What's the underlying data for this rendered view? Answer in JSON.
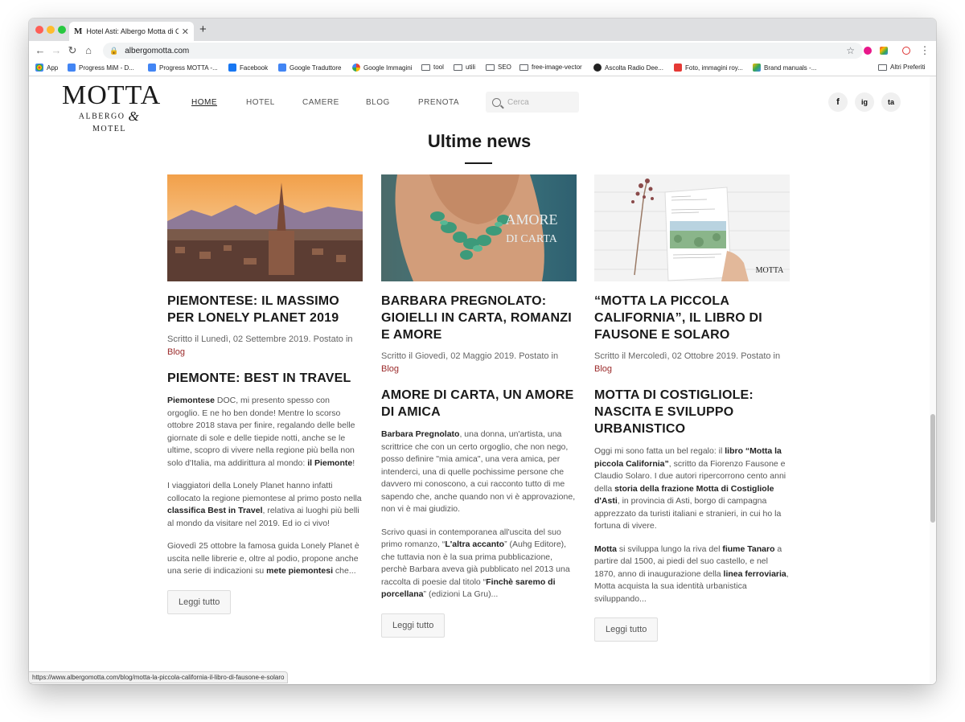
{
  "browser": {
    "tab_title": "Hotel Asti: Albergo Motta di Co",
    "tab_favicon": "M",
    "new_tab": "+",
    "url": "albergomotta.com",
    "status_url": "https://www.albergomotta.com/blog/motta-la-piccola-california-il-libro-di-fausone-e-solaro",
    "bookmarks": [
      "App",
      "Progress MiM - D...",
      "Progress MOTTA -...",
      "Facebook",
      "Google Traduttore",
      "Google Immagini",
      "tool",
      "utili",
      "SEO",
      "free-image-vector",
      "Ascolta Radio Dee...",
      "Foto, immagini roy...",
      "Brand manuals -...",
      "Altri Preferiti"
    ]
  },
  "site": {
    "logo_main": "MOTTA",
    "logo_sub_left": "ALBERGO",
    "logo_amp": "&",
    "logo_sub_right": "MOTEL",
    "nav": [
      "HOME",
      "HOTEL",
      "CAMERE",
      "BLOG",
      "PRENOTA"
    ],
    "search_placeholder": "Cerca",
    "social": [
      "f",
      "ig",
      "ta"
    ]
  },
  "section_title": "Ultime news",
  "articles": [
    {
      "title": "PIEMONTESE: IL MASSIMO PER LONELY PLANET 2019",
      "meta": "Scritto il Lunedì, 02 Settembre 2019. Postato in",
      "category": "Blog",
      "subtitle": "PIEMONTE: BEST IN TRAVEL",
      "p1_b1": "Piemontese",
      "p1_t1": " DOC, mi presento spesso con orgoglio. E ne ho ben donde! Mentre lo scorso ottobre 2018 stava per finire, regalando delle belle giornate di sole e delle tiepide notti, anche se le ultime, scopro di vivere nella regione più bella non solo d'Italia, ma addirittura al mondo: ",
      "p1_b2": "il Piemonte",
      "p1_t2": "!",
      "p2_t1": "I viaggiatori della Lonely Planet hanno infatti collocato la regione piemontese al primo posto nella ",
      "p2_b1": "classifica Best in Travel",
      "p2_t2": ", relativa ai luoghi più belli al mondo da visitare nel 2019. Ed io ci vivo!",
      "p3_t1": "Giovedì 25 ottobre la famosa guida Lonely Planet è uscita nelle librerie e, oltre al podio, propone anche una serie di indicazioni su ",
      "p3_b1": "mete piemontesi",
      "p3_t2": " che...",
      "button": "Leggi tutto"
    },
    {
      "title": "BARBARA PREGNOLATO: GIOIELLI IN CARTA, ROMANZI E AMORE",
      "meta": "Scritto il Giovedì, 02 Maggio 2019. Postato in",
      "category": "Blog",
      "subtitle": "AMORE DI CARTA, UN AMORE DI AMICA",
      "image_text_1": "AMORE",
      "image_text_2": "DI CARTA",
      "p1_b1": "Barbara Pregnolato",
      "p1_t1": ", una donna, un'artista, una scrittrice che con un certo orgoglio, che non nego, posso definire \"mia amica\", una vera amica, per intenderci, una di quelle pochissime persone che davvero mi conoscono, a cui racconto tutto di me sapendo che, anche quando non vi è approvazione, non vi è mai giudizio.",
      "p2_t1": "Scrivo quasi in contemporanea all'uscita del suo primo romanzo, “",
      "p2_b1": "L'altra accanto",
      "p2_t2": "” (Auhg Editore), che tuttavia non è la sua prima pubblicazione, perchè Barbara aveva già pubblicato nel 2013 una raccolta di poesie dal titolo “",
      "p2_b2": "Finchè saremo di porcellana",
      "p2_t3": "” (edizioni La Gru)...",
      "button": "Leggi tutto"
    },
    {
      "title": "“MOTTA LA PICCOLA CALIFORNIA”, IL LIBRO DI FAUSONE E SOLARO",
      "meta": "Scritto il Mercoledì, 02 Ottobre 2019. Postato in",
      "category": "Blog",
      "subtitle": "MOTTA DI COSTIGLIOLE: NASCITA E SVILUPPO URBANISTICO",
      "book_logo": "MOTTA",
      "p1_t1": "Oggi mi sono fatta un bel regalo: il ",
      "p1_b1": "libro “Motta la piccola California”",
      "p1_t2": ", scritto da Fiorenzo Fausone e Claudio Solaro. I due autori ripercorrono cento anni della ",
      "p1_b2": "storia della frazione Motta di Costigliole d'Asti",
      "p1_t3": ", in provincia di Asti, borgo di campagna apprezzato da turisti italiani e stranieri, in cui ho la fortuna di vivere.",
      "p2_b1": "Motta",
      "p2_t1": " si sviluppa lungo la riva del ",
      "p2_b2": "fiume Tanaro",
      "p2_t2": " a partire dal 1500, ai piedi del suo castello, e nel 1870, anno di inaugurazione della ",
      "p2_b3": "linea ferroviaria",
      "p2_t3": ", Motta acquista la sua identità urbanistica sviluppando...",
      "button": "Leggi tutto"
    }
  ]
}
